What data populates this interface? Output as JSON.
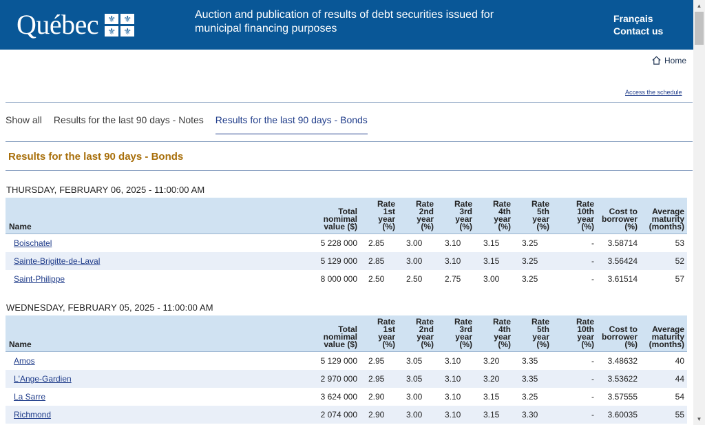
{
  "header": {
    "logo_text": "Québec",
    "fleur": "⚜",
    "title": "Auction and publication of results of debt securities issued for municipal financing purposes",
    "links": [
      "Français",
      "Contact us"
    ]
  },
  "nav": {
    "home_label": "Home",
    "schedule_link": "Access the schedule"
  },
  "tabs": [
    {
      "label": "Show all"
    },
    {
      "label": "Results for the last 90 days - Notes"
    },
    {
      "label": "Results for the last 90 days - Bonds",
      "active": true
    }
  ],
  "section_title": "Results for the last 90 days - Bonds",
  "columns": {
    "name": "Name",
    "total": [
      "Total",
      "nomimal",
      "value ($)"
    ],
    "r1": [
      "Rate",
      "1st",
      "year",
      "(%)"
    ],
    "r2": [
      "Rate",
      "2nd",
      "year",
      "(%)"
    ],
    "r3": [
      "Rate",
      "3rd",
      "year",
      "(%)"
    ],
    "r4": [
      "Rate",
      "4th",
      "year",
      "(%)"
    ],
    "r5": [
      "Rate",
      "5th",
      "year",
      "(%)"
    ],
    "r10": [
      "Rate",
      "10th",
      "year",
      "(%)"
    ],
    "cost": [
      "Cost to",
      "borrower",
      "(%)"
    ],
    "maturity": [
      "Average",
      "maturity",
      "(months)"
    ]
  },
  "days": [
    {
      "date": "THURSDAY, FEBRUARY 06, 2025 - 11:00:00 AM",
      "rows": [
        {
          "name": "Boischatel",
          "total": "5 228 000",
          "r1": "2.85",
          "r2": "3.00",
          "r3": "3.10",
          "r4": "3.15",
          "r5": "3.25",
          "r10": "-",
          "cost": "3.58714",
          "maturity": "53"
        },
        {
          "name": "Sainte-Brigitte-de-Laval",
          "total": "5 129 000",
          "r1": "2.85",
          "r2": "3.00",
          "r3": "3.10",
          "r4": "3.15",
          "r5": "3.25",
          "r10": "-",
          "cost": "3.56424",
          "maturity": "52"
        },
        {
          "name": "Saint-Philippe",
          "total": "8 000 000",
          "r1": "2.50",
          "r2": "2.50",
          "r3": "2.75",
          "r4": "3.00",
          "r5": "3.25",
          "r10": "-",
          "cost": "3.61514",
          "maturity": "57"
        }
      ]
    },
    {
      "date": "WEDNESDAY, FEBRUARY 05, 2025 - 11:00:00 AM",
      "rows": [
        {
          "name": "Amos",
          "total": "5 129 000",
          "r1": "2.95",
          "r2": "3.05",
          "r3": "3.10",
          "r4": "3.20",
          "r5": "3.35",
          "r10": "-",
          "cost": "3.48632",
          "maturity": "40"
        },
        {
          "name": "L'Ange-Gardien",
          "total": "2 970 000",
          "r1": "2.95",
          "r2": "3.05",
          "r3": "3.10",
          "r4": "3.20",
          "r5": "3.35",
          "r10": "-",
          "cost": "3.53622",
          "maturity": "44"
        },
        {
          "name": "La Sarre",
          "total": "3 624 000",
          "r1": "2.90",
          "r2": "3.00",
          "r3": "3.10",
          "r4": "3.15",
          "r5": "3.25",
          "r10": "-",
          "cost": "3.57555",
          "maturity": "54"
        },
        {
          "name": "Richmond",
          "total": "2 074 000",
          "r1": "2.90",
          "r2": "3.00",
          "r3": "3.10",
          "r4": "3.15",
          "r5": "3.30",
          "r10": "-",
          "cost": "3.60035",
          "maturity": "55"
        }
      ]
    }
  ]
}
